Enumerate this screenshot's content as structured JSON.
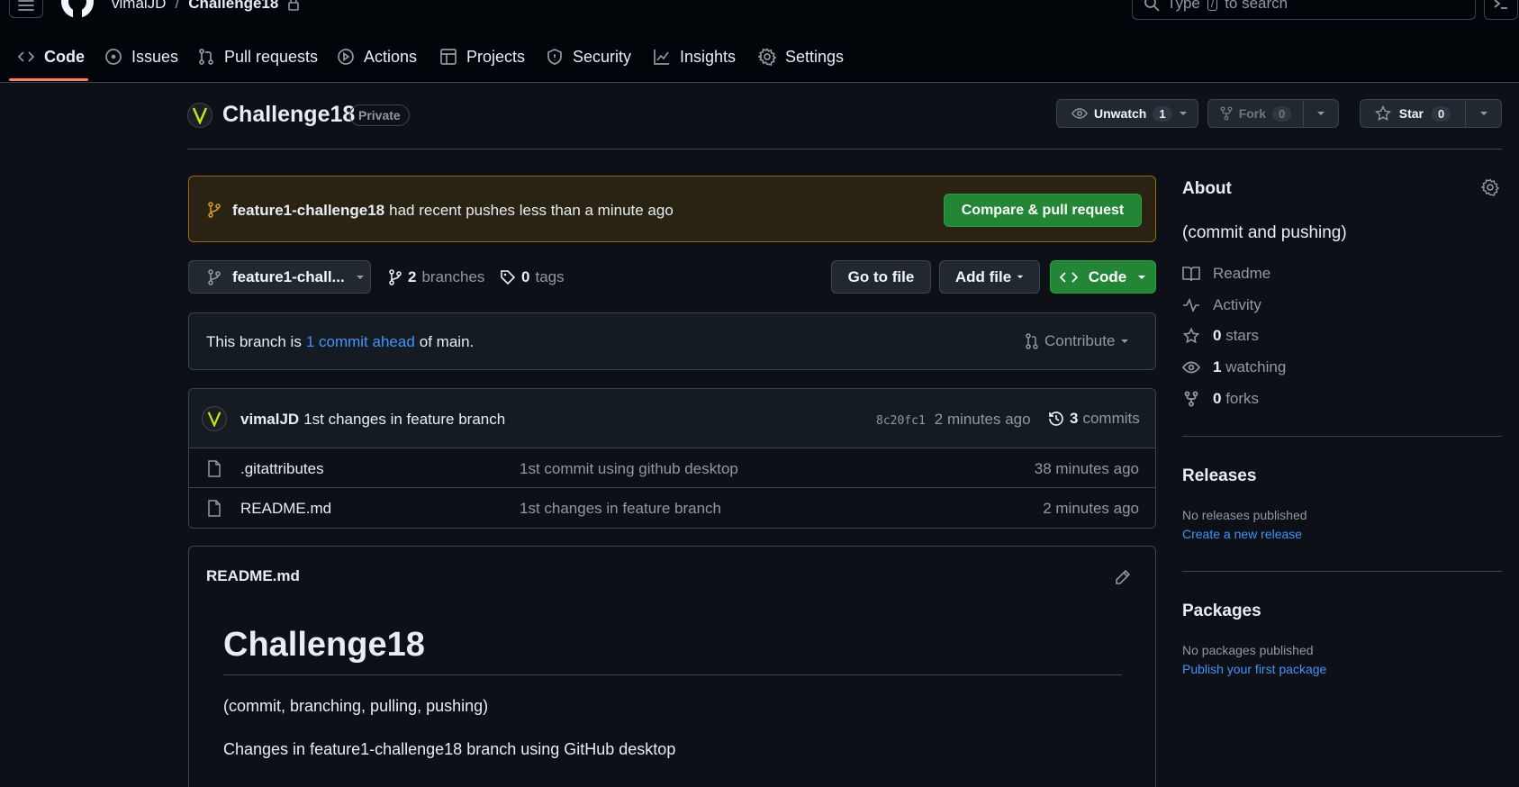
{
  "header": {
    "owner": "vimalJD",
    "separator": "/",
    "repo": "Challenge18",
    "search_placeholder_pre": "Type",
    "search_key": "/",
    "search_placeholder_post": "to search"
  },
  "tabs": [
    {
      "label": "Code"
    },
    {
      "label": "Issues"
    },
    {
      "label": "Pull requests"
    },
    {
      "label": "Actions"
    },
    {
      "label": "Projects"
    },
    {
      "label": "Security"
    },
    {
      "label": "Insights"
    },
    {
      "label": "Settings"
    }
  ],
  "repo_head": {
    "name": "Challenge18",
    "visibility": "Private",
    "unwatch_label": "Unwatch",
    "watch_count": "1",
    "fork_label": "Fork",
    "fork_count": "0",
    "star_label": "Star",
    "star_count": "0"
  },
  "banner": {
    "branch": "feature1-challenge18",
    "message": "had recent pushes less than a minute ago",
    "button": "Compare & pull request"
  },
  "toolbar": {
    "branch_select": "feature1-chall...",
    "branches_count": "2",
    "branches_label": "branches",
    "tags_count": "0",
    "tags_label": "tags",
    "go_to_file": "Go to file",
    "add_file": "Add file",
    "code": "Code"
  },
  "branch_status": {
    "prefix": "This branch is",
    "link": "1 commit ahead",
    "suffix": "of main.",
    "contribute": "Contribute"
  },
  "latest_commit": {
    "author": "vimalJD",
    "message": "1st changes in feature branch",
    "sha": "8c20fc1",
    "time": "2 minutes ago",
    "commits_count": "3",
    "commits_label": "commits"
  },
  "files": [
    {
      "name": ".gitattributes",
      "message": "1st commit using github desktop",
      "time": "38 minutes ago"
    },
    {
      "name": "README.md",
      "message": "1st changes in feature branch",
      "time": "2 minutes ago"
    }
  ],
  "readme": {
    "filename": "README.md",
    "title": "Challenge18",
    "line1": "(commit, branching, pulling, pushing)",
    "line2": "Changes in feature1-challenge18 branch using GitHub desktop"
  },
  "about": {
    "heading": "About",
    "description": "(commit and pushing)",
    "readme": "Readme",
    "activity": "Activity",
    "stars_count": "0",
    "stars_label": "stars",
    "watching_count": "1",
    "watching_label": "watching",
    "forks_count": "0",
    "forks_label": "forks"
  },
  "releases": {
    "heading": "Releases",
    "empty": "No releases published",
    "link": "Create a new release"
  },
  "packages": {
    "heading": "Packages",
    "empty": "No packages published",
    "link": "Publish your first package"
  },
  "colors": {
    "background": "#0d1117",
    "header": "#010409",
    "accent_green": "#238636",
    "link": "#4493f8",
    "tab_underline": "#f78166",
    "banner_border": "#9e6a03"
  }
}
